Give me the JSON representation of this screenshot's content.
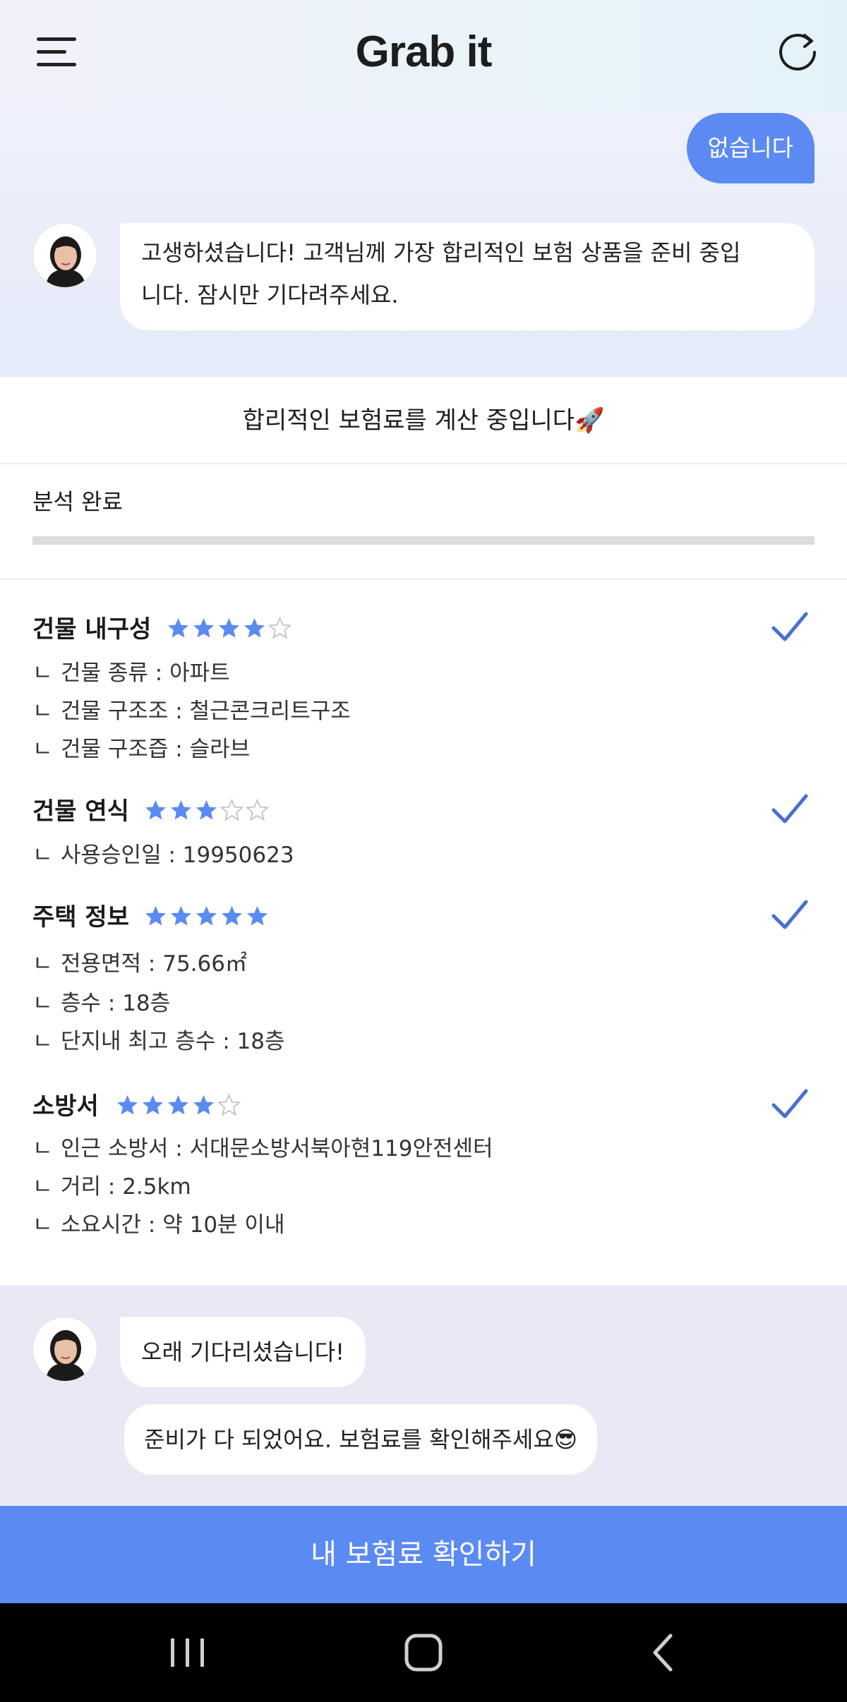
{
  "header": {
    "logo": "Grab it"
  },
  "chat_top": {
    "user_message": "없습니다",
    "bot_message_line1": "고생하셨습니다! 고객님께 가장 합리적인 보험 상품을 준비 중입",
    "bot_message_line2": "니다. 잠시만 기다려주세요."
  },
  "status": {
    "title": "합리적인 보험료를 계산 중입니다🚀",
    "analysis_label": "분석 완료",
    "progress_percent": 100
  },
  "sections": [
    {
      "title": "건물 내구성",
      "rating": 4,
      "max_rating": 5,
      "details": [
        "건물 종류 : 아파트",
        "건물 구조조 : 철근콘크리트구조",
        "건물 구조즙 : 슬라브"
      ]
    },
    {
      "title": "건물 연식",
      "rating": 3,
      "max_rating": 5,
      "details": [
        "사용승인일 : 19950623"
      ]
    },
    {
      "title": "주택 정보",
      "rating": 5,
      "max_rating": 5,
      "details": [
        "전용면적 : 75.66㎡",
        "층수 : 18층",
        "단지내 최고 층수 : 18층"
      ]
    },
    {
      "title": "소방서",
      "rating": 4,
      "max_rating": 5,
      "details": [
        "인근 소방서 : 서대문소방서북아현119안전센터",
        "거리 : 2.5km",
        "소요시간 : 약 10분 이내"
      ]
    }
  ],
  "detail_prefix": "ㄴ",
  "chat_bottom": {
    "message1": "오래 기다리셨습니다!",
    "message2": "준비가 다 되었어요. 보험료를 확인해주세요😎"
  },
  "cta": {
    "label": "내 보험료 확인하기"
  },
  "colors": {
    "accent": "#5b8af2",
    "star_filled": "#5b8af2",
    "check": "#4a6fcf",
    "star_empty": "#c8c8c8"
  },
  "icons": {
    "menu": "hamburger-menu-icon",
    "refresh": "refresh-icon",
    "check": "check-icon",
    "star": "star-icon",
    "nav_recent": "recent-apps-icon",
    "nav_home": "home-icon",
    "nav_back": "back-icon"
  }
}
